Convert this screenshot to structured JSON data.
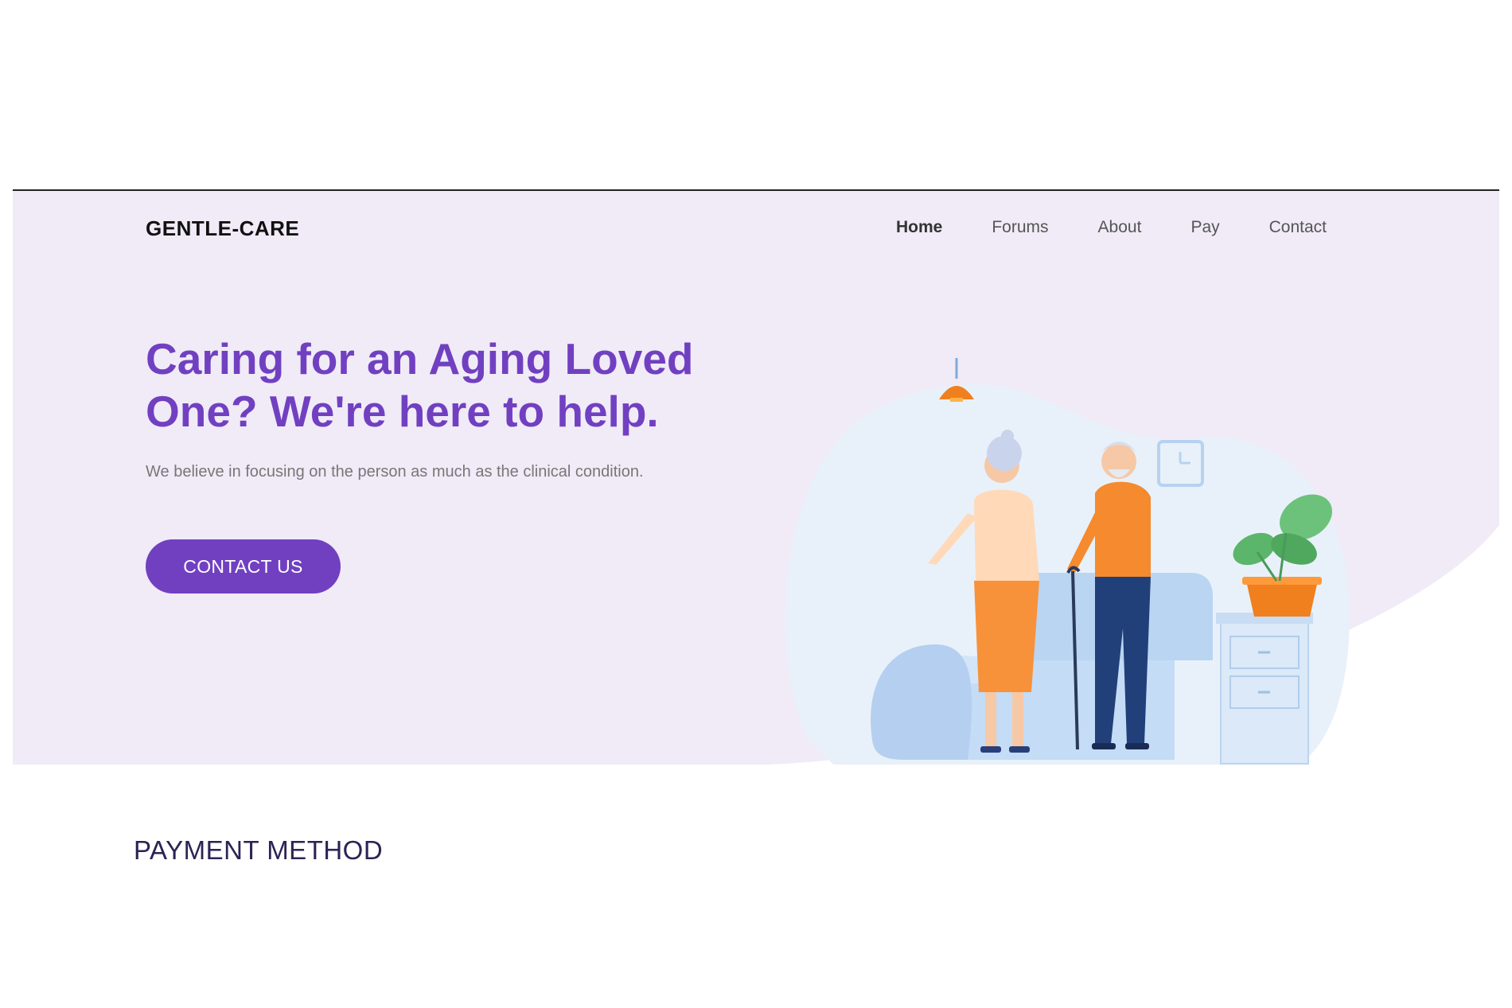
{
  "brand": {
    "name": "GENTLE-CARE"
  },
  "nav": {
    "items": [
      {
        "label": "Home",
        "active": true
      },
      {
        "label": "Forums",
        "active": false
      },
      {
        "label": "About",
        "active": false
      },
      {
        "label": "Pay",
        "active": false
      },
      {
        "label": "Contact",
        "active": false
      }
    ]
  },
  "hero": {
    "headline": "Caring for an Aging Loved One? We're here to help.",
    "subtext": "We believe in focusing on the person as much as the clinical condition.",
    "cta_label": "CONTACT US",
    "illustration_icon": "elderly-couple-illustration"
  },
  "sections": {
    "payment_title": "PAYMENT METHOD"
  },
  "colors": {
    "accent": "#7140c1",
    "hero_bg": "#f0ebf7",
    "title_dark": "#2a2455"
  }
}
